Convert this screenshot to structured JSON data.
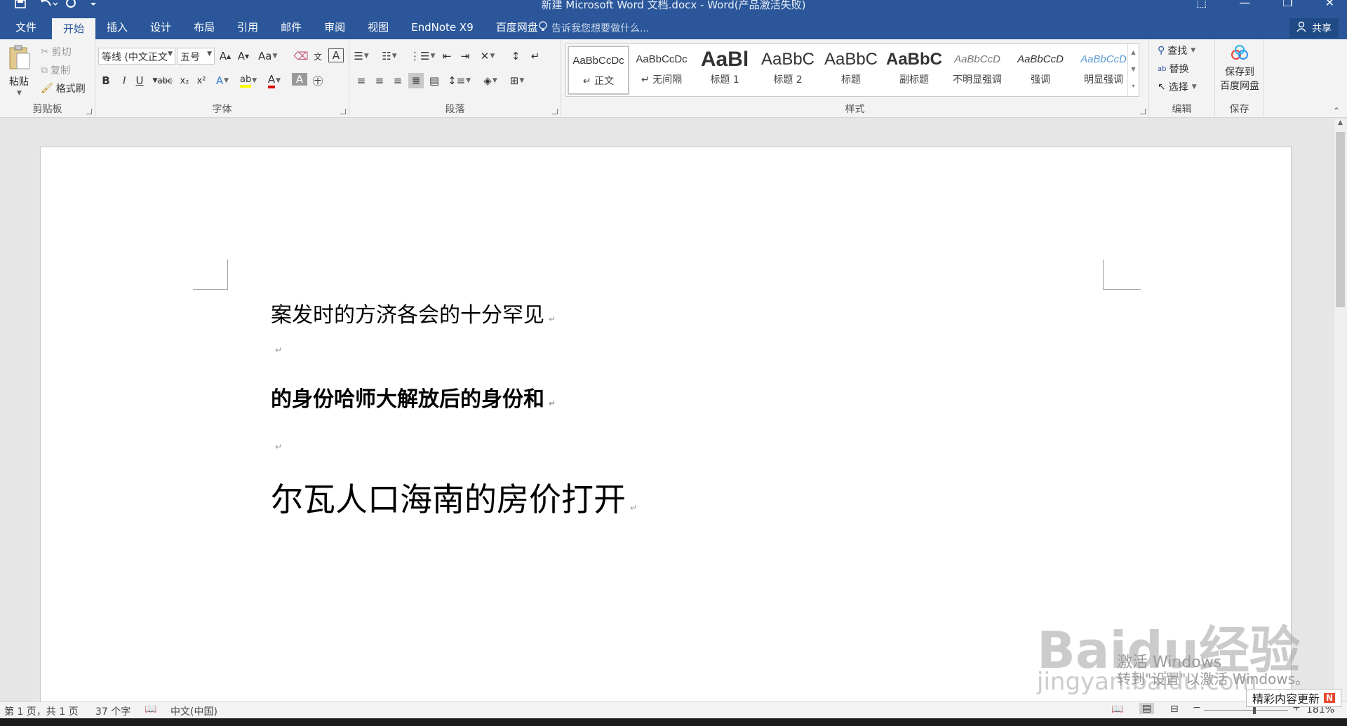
{
  "window": {
    "title": "新建 Microsoft Word 文档.docx - Word(产品激活失败)"
  },
  "tabs": [
    "文件",
    "开始",
    "插入",
    "设计",
    "布局",
    "引用",
    "邮件",
    "审阅",
    "视图",
    "EndNote X9",
    "百度网盘"
  ],
  "active_tab": "开始",
  "tell_me": "告诉我您想要做什么...",
  "share_label": "共享",
  "clipboard": {
    "paste": "粘贴",
    "cut": "剪切",
    "copy": "复制",
    "format_painter": "格式刷",
    "group_label": "剪贴板"
  },
  "font": {
    "name": "等线 (中文正文",
    "size": "五号",
    "group_label": "字体",
    "bold": "B",
    "italic": "I",
    "underline": "U",
    "strike": "abc",
    "subscript": "x₂",
    "superscript": "x²",
    "change_case": "Aa",
    "font_color_letter": "A"
  },
  "paragraph": {
    "group_label": "段落"
  },
  "styles": {
    "group_label": "样式",
    "items": [
      {
        "sample": "AaBbCcDc",
        "label": "正文"
      },
      {
        "sample": "AaBbCcDc",
        "label": "无间隔"
      },
      {
        "sample": "AaBl",
        "label": "标题 1"
      },
      {
        "sample": "AaBbC",
        "label": "标题 2"
      },
      {
        "sample": "AaBbC",
        "label": "标题"
      },
      {
        "sample": "AaBbC",
        "label": "副标题"
      },
      {
        "sample": "AaBbCcD",
        "label": "不明显强调"
      },
      {
        "sample": "AaBbCcD",
        "label": "强调"
      },
      {
        "sample": "AaBbCcD",
        "label": "明显强调"
      }
    ]
  },
  "editing": {
    "find": "查找",
    "replace": "替换",
    "select": "选择",
    "group_label": "编辑"
  },
  "save_group": {
    "button_line1": "保存到",
    "button_line2": "百度网盘",
    "group_label": "保存"
  },
  "document": {
    "paragraphs": [
      "案发时的方济各会的十分罕见",
      "",
      "的身份哈师大解放后的身份和",
      "",
      "尔瓦人口海南的房价打开"
    ]
  },
  "status": {
    "page": "第 1 页，共 1 页",
    "words": "37 个字",
    "language": "中文(中国)",
    "zoom": "181%"
  },
  "watermarks": {
    "activate_title": "激活 Windows",
    "activate_sub": "转到\"设置\"以激活 Windows。",
    "baidu_logo": "Baidu经验",
    "baidu_url": "jingyan.baidu.com",
    "toast": "精彩内容更新",
    "toast_badge": "N"
  }
}
